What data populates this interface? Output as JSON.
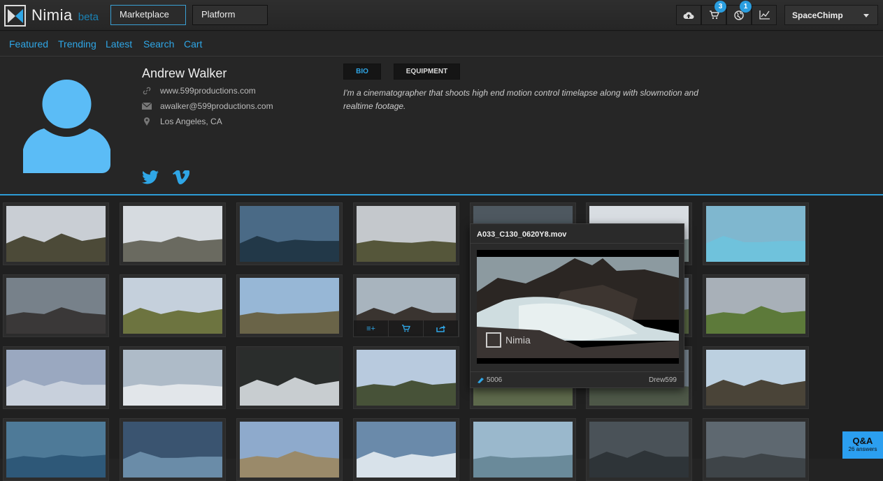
{
  "header": {
    "brand": "Nimia",
    "beta": "beta",
    "tabs": [
      {
        "label": "Marketplace"
      },
      {
        "label": "Platform"
      }
    ],
    "icons": [
      {
        "name": "cloud-upload-icon"
      },
      {
        "name": "cart-icon",
        "badge": "3"
      },
      {
        "name": "globe-icon",
        "badge": "1"
      },
      {
        "name": "chart-icon"
      }
    ],
    "user": "SpaceChimp"
  },
  "subnav": [
    "Featured",
    "Trending",
    "Latest",
    "Search",
    "Cart"
  ],
  "profile": {
    "name": "Andrew Walker",
    "website": "www.599productions.com",
    "email": "awalker@599productions.com",
    "location": "Los Angeles, CA",
    "tabs": [
      "BIO",
      "EQUIPMENT"
    ],
    "bio": "I'm a cinematographer that shoots high end motion control timelapse along with slowmotion and realtime footage."
  },
  "popup": {
    "filename": "A033_C130_0620Y8.mov",
    "views": "5006",
    "user": "Drew599",
    "watermark": "Nimia"
  },
  "hover_actions": [
    "≡+",
    "cart",
    "share"
  ],
  "qa": {
    "title": "Q&A",
    "count": "26 answers"
  },
  "colors": {
    "accent": "#2fa6e6",
    "avatar": "#5bbcf6"
  }
}
